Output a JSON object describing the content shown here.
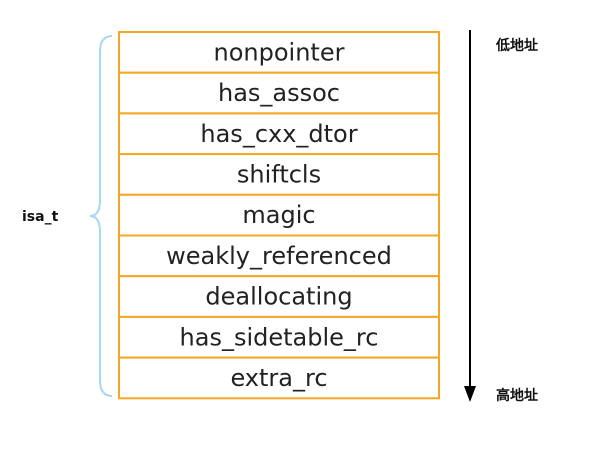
{
  "struct_label": "isa_t",
  "fields": [
    "nonpointer",
    "has_assoc",
    "has_cxx_dtor",
    "shiftcls",
    "magic",
    "weakly_referenced",
    "deallocating",
    "has_sidetable_rc",
    "extra_rc"
  ],
  "address": {
    "low_label": "低地址",
    "high_label": "高地址"
  },
  "colors": {
    "cell_border": "#f5a623",
    "brace": "#a8d8f0",
    "arrow": "#000000"
  }
}
